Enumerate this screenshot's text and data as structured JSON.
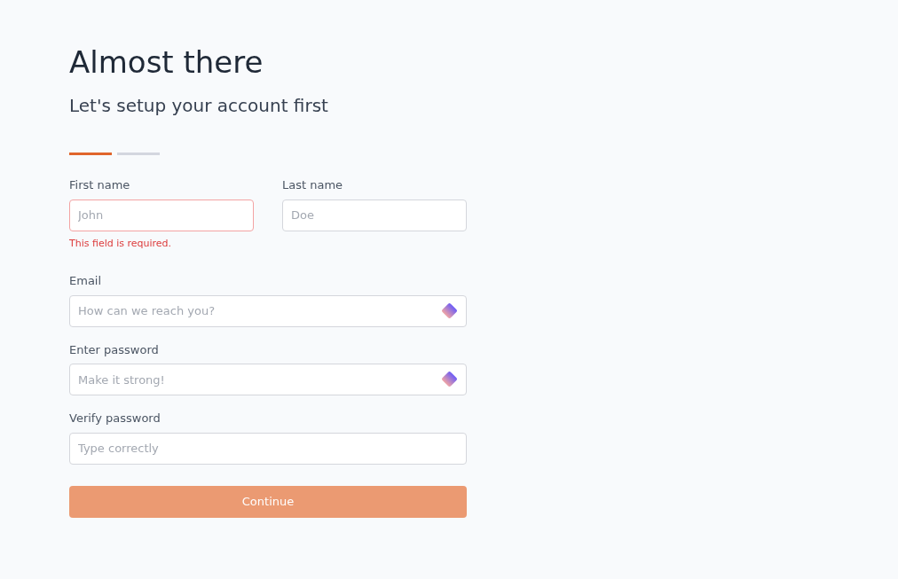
{
  "title": "Almost there",
  "subtitle": "Let's setup your account first",
  "steps": [
    {
      "selected": true
    },
    {
      "selected": false
    }
  ],
  "name_fields": [
    {
      "label": "First name",
      "placeholder": "John",
      "error": "This field is required."
    },
    {
      "label": "Last name",
      "placeholder": "Doe"
    }
  ],
  "fields": [
    {
      "label": "Email",
      "placeholder": "How can we reach you?",
      "autofill_icon": true
    },
    {
      "label": "Enter password",
      "placeholder": "Make it strong!",
      "autofill_icon": true
    },
    {
      "label": "Verify password",
      "placeholder": "Type correctly",
      "autofill_icon": false
    }
  ],
  "submit": {
    "label": "Continue",
    "disabled": true
  }
}
